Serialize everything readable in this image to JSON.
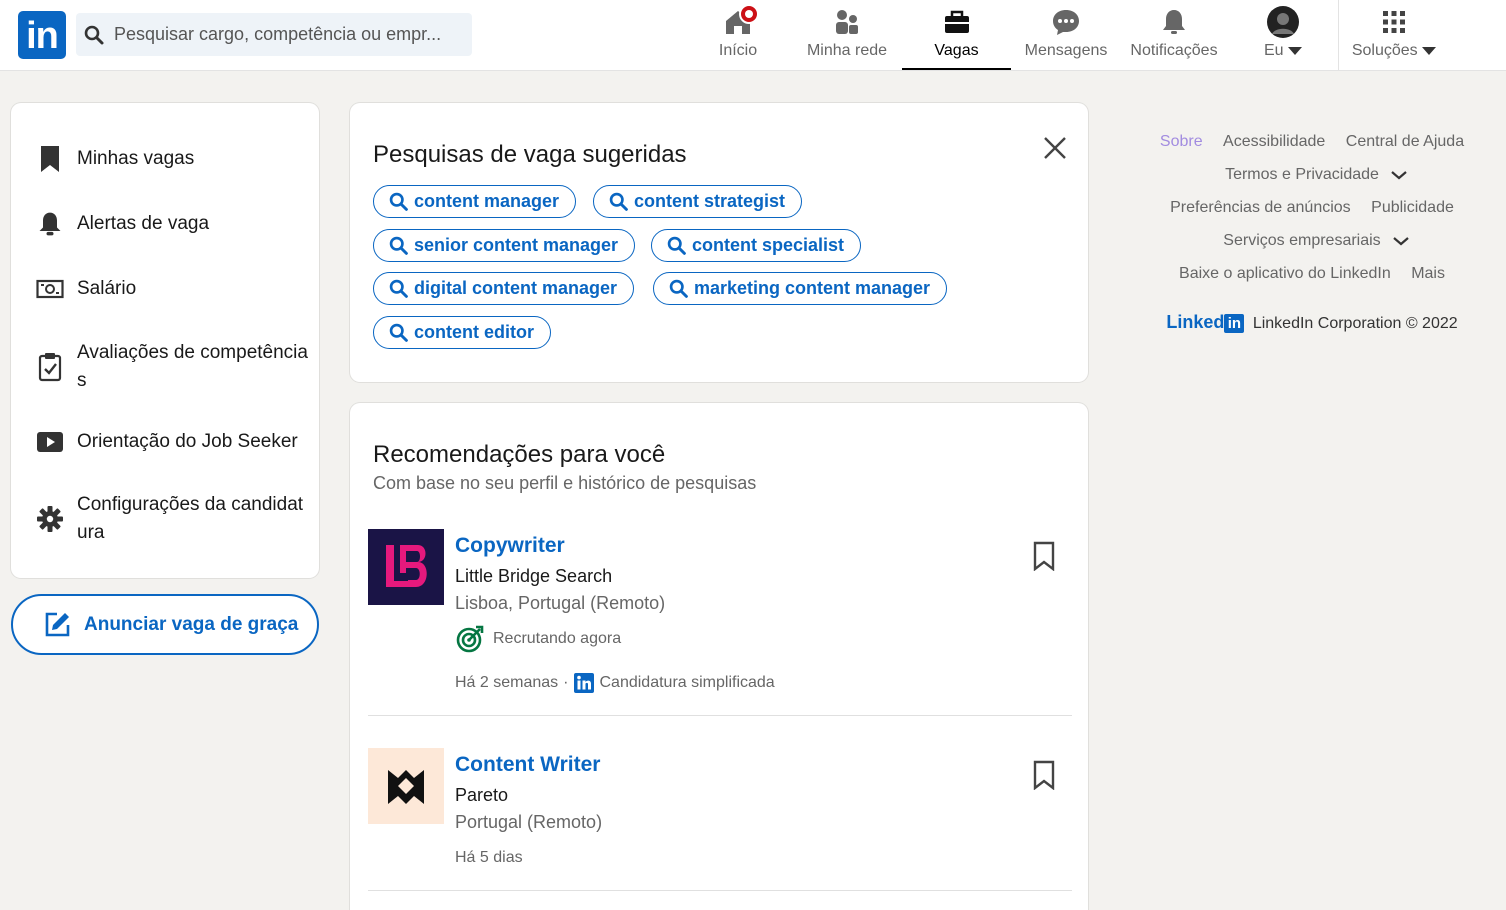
{
  "header": {
    "search_placeholder": "Pesquisar cargo, competência ou empr...",
    "nav": [
      {
        "label": "Início",
        "icon": "home-icon"
      },
      {
        "label": "Minha rede",
        "icon": "network-icon"
      },
      {
        "label": "Vagas",
        "icon": "briefcase-icon",
        "active": true
      },
      {
        "label": "Mensagens",
        "icon": "messaging-icon"
      },
      {
        "label": "Notificações",
        "icon": "bell-icon"
      },
      {
        "label": "Eu",
        "icon": "avatar"
      },
      {
        "label": "Soluções",
        "icon": "grid-icon"
      }
    ]
  },
  "sidebar": {
    "items": [
      {
        "label": "Minhas vagas",
        "icon": "bookmark-icon"
      },
      {
        "label": "Alertas de vaga",
        "icon": "bell-icon"
      },
      {
        "label": "Salário",
        "icon": "money-icon"
      },
      {
        "label": "Avaliações de competência s",
        "icon": "clipboard-check-icon"
      },
      {
        "label": "Orientação do Job Seeker",
        "icon": "video-icon"
      },
      {
        "label": "Configurações da candidat ura",
        "icon": "gear-icon"
      }
    ],
    "post_job_label": "Anunciar vaga de graça"
  },
  "suggested": {
    "title": "Pesquisas de vaga sugeridas",
    "chips": [
      "content manager",
      "content strategist",
      "senior content manager",
      "content specialist",
      "digital content manager",
      "marketing content manager",
      "content editor"
    ]
  },
  "recommendations": {
    "title": "Recomendações para você",
    "subtitle": "Com base no seu perfil e histórico de pesquisas",
    "jobs": [
      {
        "title": "Copywriter",
        "company": "Little Bridge Search",
        "location": "Lisboa, Portugal (Remoto)",
        "hiring": "Recrutando agora",
        "posted": "Há 2 semanas",
        "separator": "·",
        "easy_apply": "Candidatura simplificada",
        "logo_color": "#1a1446"
      },
      {
        "title": "Content Writer",
        "company": "Pareto",
        "location": "Portugal (Remoto)",
        "posted": "Há 5 dias",
        "logo_color": "#fde8d8"
      }
    ]
  },
  "footer": {
    "row1": [
      "Sobre",
      "Acessibilidade",
      "Central de Ajuda"
    ],
    "terms": "Termos e Privacidade",
    "row3": [
      "Preferências de anúncios",
      "Publicidade"
    ],
    "business": "Serviços empresariais",
    "row5": [
      "Baixe o aplicativo do LinkedIn",
      "Mais"
    ],
    "brand_word": "Linked",
    "brand_in": "in",
    "copyright": "LinkedIn Corporation © 2022"
  },
  "colors": {
    "brand": "#0a66c2",
    "notification": "#cc1016",
    "hiring_green": "#057642"
  }
}
